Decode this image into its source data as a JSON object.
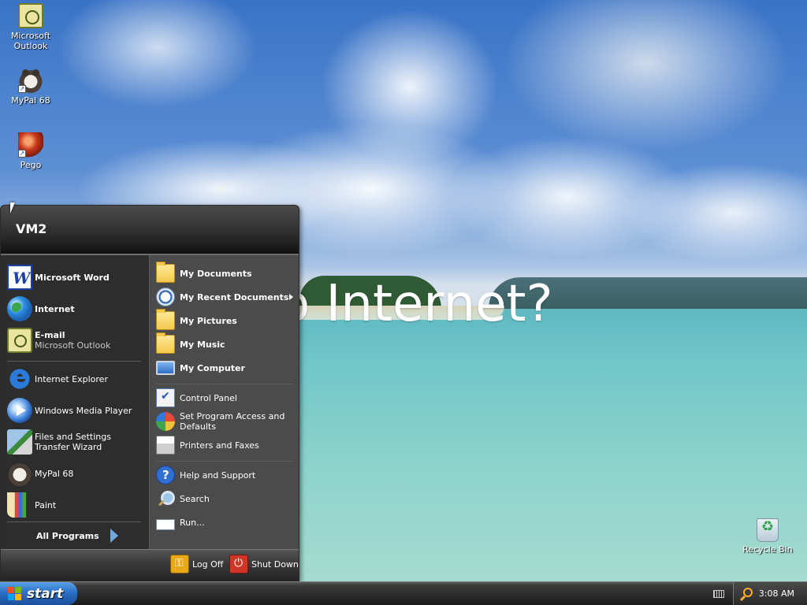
{
  "desktop": {
    "wallpaper_text": "o Internet?",
    "icons": [
      {
        "label": "Microsoft Outlook",
        "icon": "outlook-icon"
      },
      {
        "label": "MyPal 68",
        "icon": "raccoon-icon"
      },
      {
        "label": "Pego",
        "icon": "pego-icon"
      },
      {
        "label": "Recycle Bin",
        "icon": "recycle-bin-icon"
      }
    ]
  },
  "start_menu": {
    "user": "VM2",
    "pinned": [
      {
        "label": "Microsoft Word",
        "icon": "word-icon"
      },
      {
        "label": "Internet",
        "icon": "internet-globe-icon"
      },
      {
        "label": "E-mail",
        "sub": "Microsoft Outlook",
        "icon": "email-outlook-icon"
      }
    ],
    "recent": [
      {
        "label": "Internet Explorer",
        "icon": "internet-explorer-icon"
      },
      {
        "label": "Windows Media Player",
        "icon": "media-player-icon"
      },
      {
        "label": "Files and Settings Transfer Wizard",
        "icon": "transfer-wizard-icon"
      },
      {
        "label": "MyPal 68",
        "icon": "raccoon-icon"
      },
      {
        "label": "Paint",
        "icon": "paint-icon"
      }
    ],
    "all_programs": "All Programs",
    "places": [
      {
        "label": "My Documents",
        "icon": "folder-documents-icon"
      },
      {
        "label": "My Recent Documents",
        "icon": "recent-documents-icon"
      },
      {
        "label": "My Pictures",
        "icon": "folder-pictures-icon"
      },
      {
        "label": "My Music",
        "icon": "folder-music-icon"
      },
      {
        "label": "My Computer",
        "icon": "computer-icon"
      }
    ],
    "settings": [
      {
        "label": "Control Panel",
        "icon": "control-panel-icon"
      },
      {
        "label": "Set Program Access and Defaults",
        "icon": "program-access-icon"
      },
      {
        "label": "Printers and Faxes",
        "icon": "printer-icon"
      }
    ],
    "help": [
      {
        "label": "Help and Support",
        "icon": "help-icon"
      },
      {
        "label": "Search",
        "icon": "search-icon"
      },
      {
        "label": "Run...",
        "icon": "run-icon"
      }
    ],
    "log_off": "Log Off",
    "shut_down": "Shut Down"
  },
  "taskbar": {
    "start_label": "start",
    "clock": "3:08 AM"
  },
  "colors": {
    "menu_left_bg": "#2d2d2d",
    "menu_right_bg": "#4b4b4b",
    "start_button": "#2c6fc7"
  }
}
